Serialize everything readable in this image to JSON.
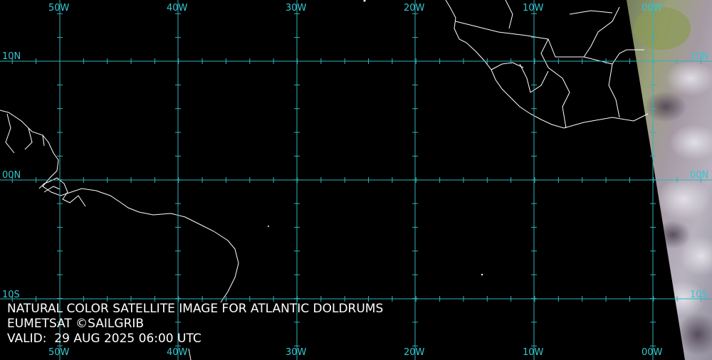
{
  "map": {
    "caption": {
      "line1": "NATURAL COLOR SATELLITE IMAGE FOR ATLANTIC DOLDRUMS",
      "line2": "EUMETSAT ©SAILGRIB",
      "line3": "VALID:  29 AUG 2025 06:00 UTC"
    },
    "longitude_labels": [
      "50W",
      "40W",
      "30W",
      "20W",
      "10W",
      "00W"
    ],
    "latitude_labels": [
      "10N",
      "00N",
      "10S"
    ],
    "colors": {
      "background": "#000000",
      "grid": "#2fb3bd",
      "grid_label": "#36c6cf",
      "coastline": "#ffffff",
      "caption": "#ffffff"
    }
  }
}
